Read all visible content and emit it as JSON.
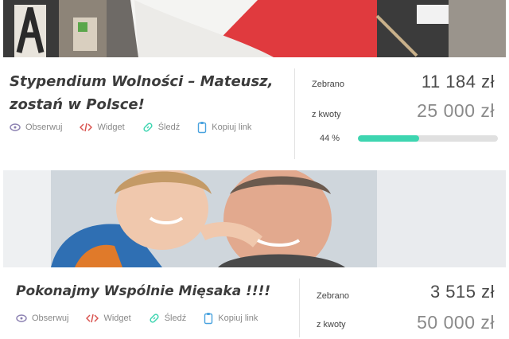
{
  "campaigns": [
    {
      "title": "Stypendium Wolności – Mateusz, zostań w Polsce!",
      "actions": {
        "observe": "Obserwuj",
        "widget": "Widget",
        "track": "Śledź",
        "copy_link": "Kopiuj link"
      },
      "raised_label": "Zebrano",
      "raised_value": "11 184 zł",
      "goal_label": "z kwoty",
      "goal_value": "25 000 zł",
      "percent_label": "44 %",
      "progress_fraction": 0.44
    },
    {
      "title": "Pokonajmy Wspólnie Mięsaka !!!!",
      "actions": {
        "observe": "Obserwuj",
        "widget": "Widget",
        "track": "Śledź",
        "copy_link": "Kopiuj link"
      },
      "raised_label": "Zebrano",
      "raised_value": "3 515 zł",
      "goal_label": "z kwoty",
      "goal_value": "50 000 zł"
    }
  ],
  "colors": {
    "progress_fill": "#3dd5b0",
    "widget_icon": "#d9534f",
    "track_icon": "#3dd5b0",
    "observe_icon": "#8a7fb0",
    "copy_icon": "#4aa3df"
  }
}
